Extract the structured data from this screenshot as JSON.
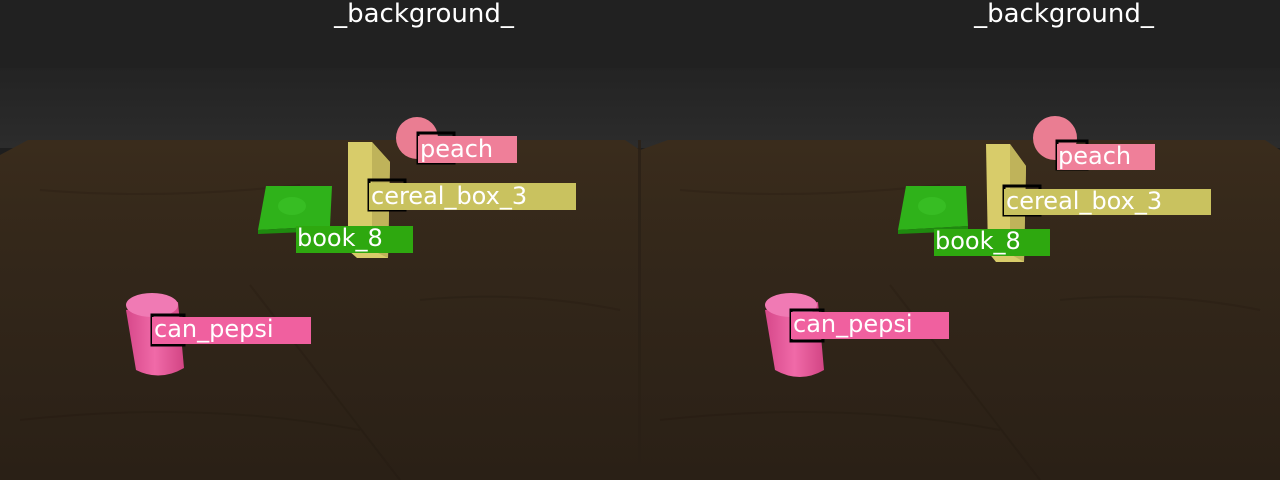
{
  "background_label": "_background_",
  "panels": [
    {
      "background_label": "_background_",
      "objects": [
        {
          "label": "peach",
          "color": "#ef7f99"
        },
        {
          "label": "cereal_box_3",
          "color": "#c9c25f"
        },
        {
          "label": "book_8",
          "color": "#2ea80f"
        },
        {
          "label": "can_pepsi",
          "color": "#f0609f"
        }
      ]
    },
    {
      "background_label": "_background_",
      "objects": [
        {
          "label": "peach",
          "color": "#ef7f99"
        },
        {
          "label": "cereal_box_3",
          "color": "#c9c25f"
        },
        {
          "label": "book_8",
          "color": "#2ea80f"
        },
        {
          "label": "can_pepsi",
          "color": "#f0609f"
        }
      ]
    }
  ]
}
